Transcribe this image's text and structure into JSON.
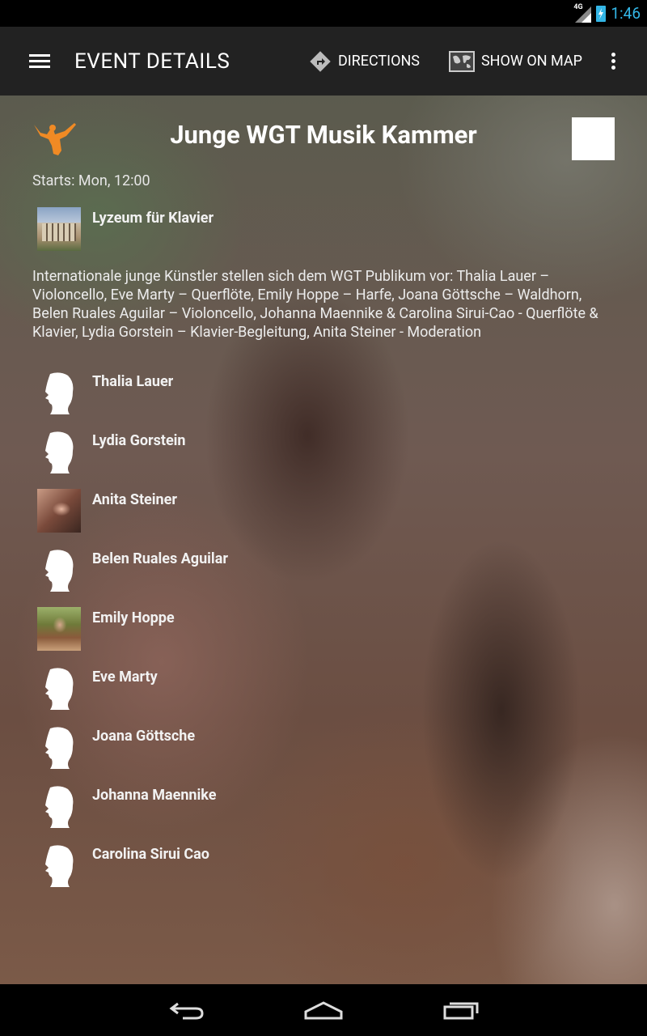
{
  "status_bar": {
    "network": "4G",
    "time": "1:46"
  },
  "action_bar": {
    "title": "EVENT DETAILS",
    "directions_label": "DIRECTIONS",
    "show_on_map_label": "SHOW ON MAP"
  },
  "event": {
    "title": "Junge WGT Musik Kammer",
    "starts": "Starts: Mon, 12:00",
    "venue": "Lyzeum für Klavier",
    "description": "Internationale junge Künstler stellen sich dem WGT Publikum vor: Thalia Lauer – Violoncello, Eve Marty – Querflöte, Emily Hoppe – Harfe, Joana Göttsche – Waldhorn, Belen Ruales Aguilar – Violoncello, Johanna Maennike & Carolina Sirui-Cao - Querflöte & Klavier, Lydia Gorstein – Klavier-Begleitung, Anita Steiner - Moderation"
  },
  "artists": [
    {
      "name": "Thalia Lauer",
      "thumb": "silhouette"
    },
    {
      "name": "Lydia Gorstein",
      "thumb": "silhouette"
    },
    {
      "name": "Anita Steiner",
      "thumb": "photo-a"
    },
    {
      "name": "Belen Ruales Aguilar",
      "thumb": "silhouette"
    },
    {
      "name": "Emily Hoppe",
      "thumb": "photo-b"
    },
    {
      "name": "Eve Marty",
      "thumb": "silhouette"
    },
    {
      "name": "Joana Göttsche",
      "thumb": "silhouette"
    },
    {
      "name": "Johanna Maennike",
      "thumb": "silhouette"
    },
    {
      "name": "Carolina Sirui Cao",
      "thumb": "silhouette"
    }
  ],
  "colors": {
    "accent": "#33b5e5",
    "action_bar": "#222222",
    "logo": "#f08a24"
  }
}
